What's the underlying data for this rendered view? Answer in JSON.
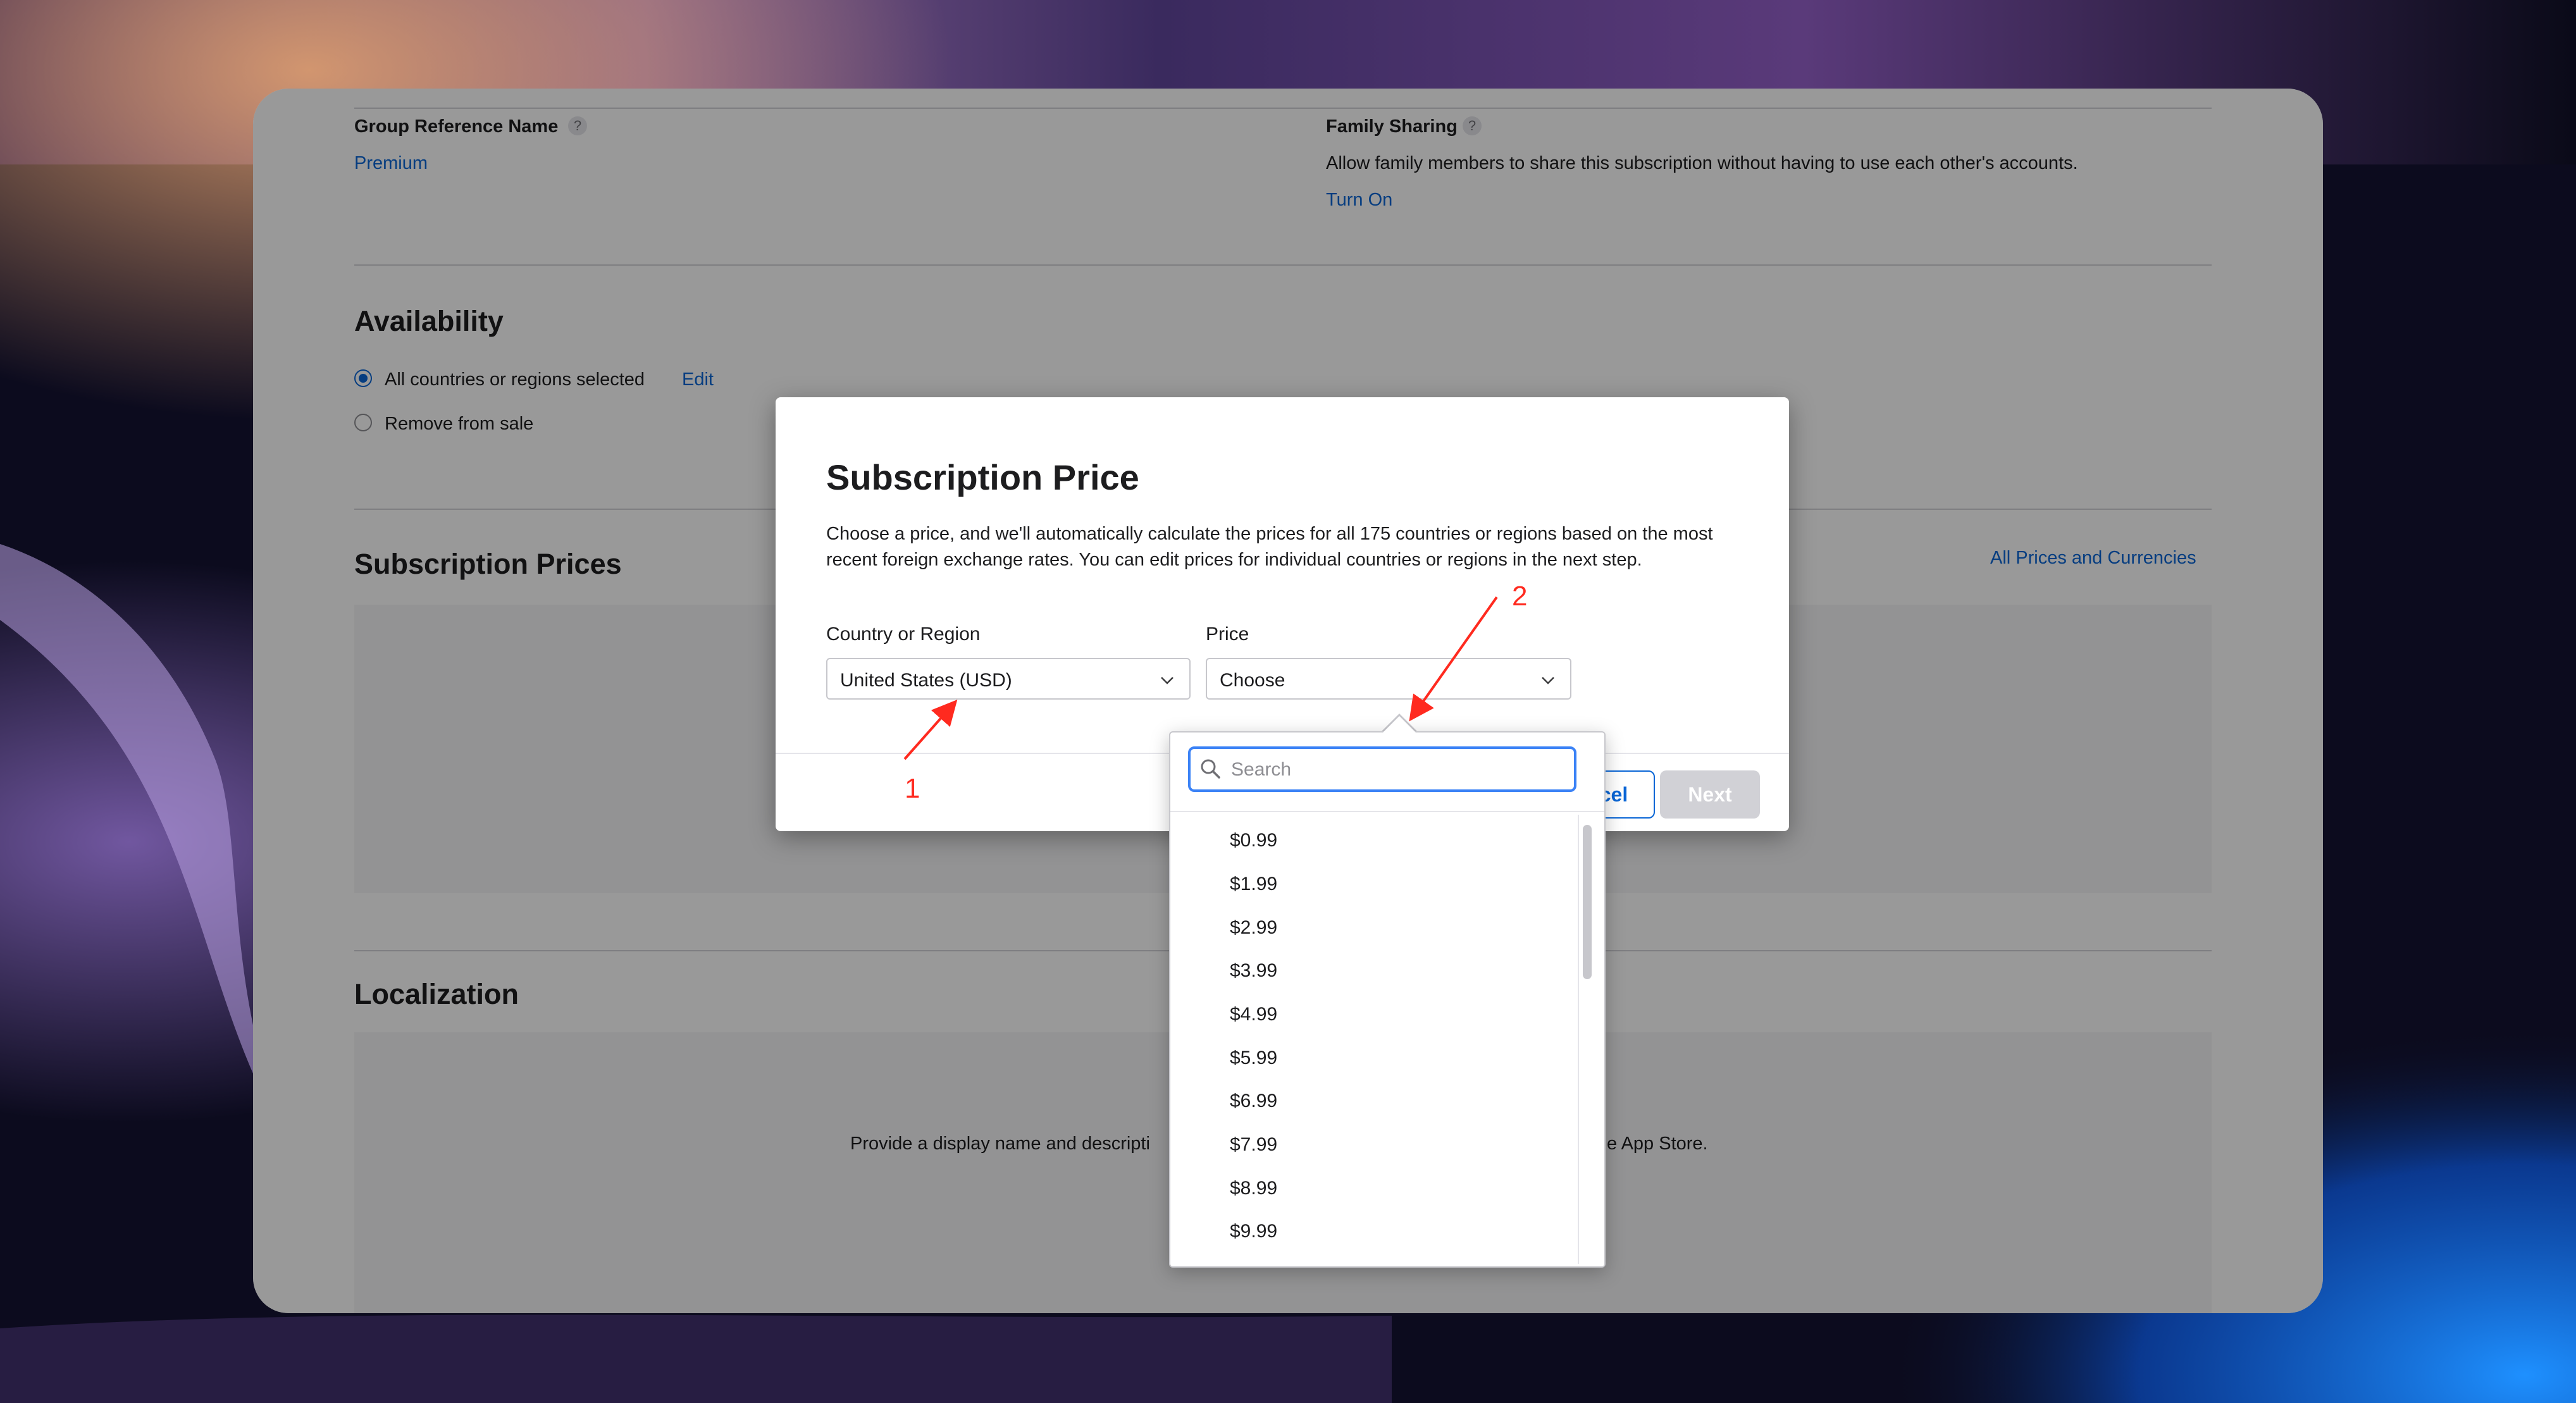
{
  "group_reference": {
    "label": "Group Reference Name",
    "help": "?",
    "value": "Premium"
  },
  "family_sharing": {
    "label": "Family Sharing",
    "help": "?",
    "description": "Allow family members to share this subscription without having to use each other's accounts.",
    "action": "Turn On"
  },
  "availability": {
    "title": "Availability",
    "options": [
      {
        "label": "All countries or regions selected",
        "selected": true
      },
      {
        "label": "Remove from sale",
        "selected": false
      }
    ],
    "edit_label": "Edit"
  },
  "subscription_prices": {
    "title": "Subscription Prices",
    "link": "All Prices and Currencies"
  },
  "localization": {
    "title": "Localization",
    "text_left": "Provide a display name and descripti",
    "text_right": "e App Store."
  },
  "modal": {
    "title": "Subscription Price",
    "description": "Choose a price, and we'll automatically calculate the prices for all 175 countries or regions based on the most recent foreign exchange rates. You can edit prices for individual countries or regions in the next step.",
    "country_label": "Country or Region",
    "country_value": "United States (USD)",
    "price_label": "Price",
    "price_value": "Choose",
    "cancel_label": "cel",
    "next_label": "Next"
  },
  "dropdown": {
    "search_placeholder": "Search",
    "items": [
      "$0.99",
      "$1.99",
      "$2.99",
      "$3.99",
      "$4.99",
      "$5.99",
      "$6.99",
      "$7.99",
      "$8.99",
      "$9.99"
    ]
  },
  "annotations": {
    "marker_1": "1",
    "marker_2": "2",
    "color": "#ff2a1f"
  },
  "colors": {
    "accent": "#0a66d6",
    "focus": "#3b82f6",
    "disabled_button": "#d1d1d6"
  }
}
